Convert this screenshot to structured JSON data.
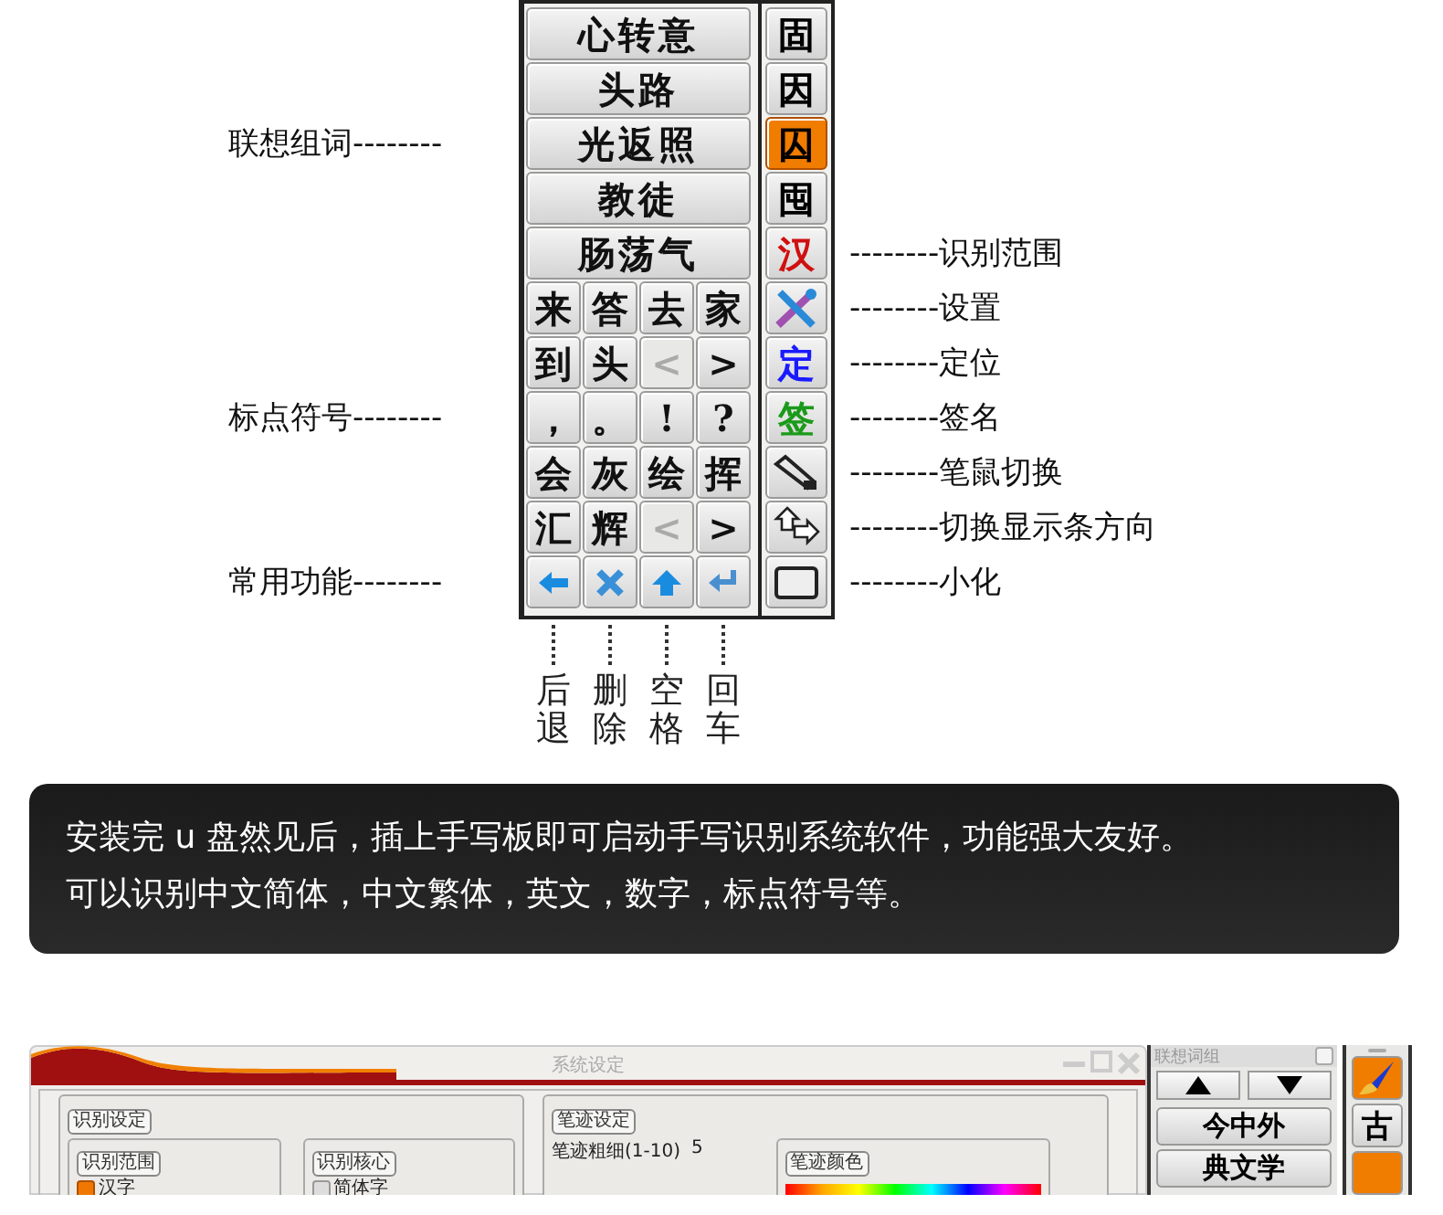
{
  "panel": {
    "word_group": {
      "callout": "联想组词--------",
      "words": [
        "心转意",
        "头路",
        "光返照",
        "教徒",
        "肠荡气"
      ]
    },
    "key_rows": [
      {
        "keys": [
          {
            "kind": "char",
            "label": "来",
            "disabled": false
          },
          {
            "kind": "char",
            "label": "答",
            "disabled": false
          },
          {
            "kind": "char",
            "label": "去",
            "disabled": false
          },
          {
            "kind": "char",
            "label": "家",
            "disabled": false
          }
        ]
      },
      {
        "keys": [
          {
            "kind": "char",
            "label": "到",
            "disabled": false
          },
          {
            "kind": "char",
            "label": "头",
            "disabled": false
          },
          {
            "kind": "char",
            "label": "<",
            "disabled": true
          },
          {
            "kind": "char",
            "label": ">",
            "disabled": false
          }
        ]
      },
      {
        "callout": "标点符号--------",
        "keys": [
          {
            "kind": "char",
            "label": "，",
            "disabled": false
          },
          {
            "kind": "char",
            "label": "。",
            "disabled": false
          },
          {
            "kind": "char",
            "label": "!",
            "disabled": false
          },
          {
            "kind": "char",
            "label": "?",
            "disabled": false
          }
        ]
      },
      {
        "keys": [
          {
            "kind": "char",
            "label": "会",
            "disabled": false
          },
          {
            "kind": "char",
            "label": "灰",
            "disabled": false
          },
          {
            "kind": "char",
            "label": "绘",
            "disabled": false
          },
          {
            "kind": "char",
            "label": "挥",
            "disabled": false
          }
        ]
      },
      {
        "keys": [
          {
            "kind": "char",
            "label": "汇",
            "disabled": false
          },
          {
            "kind": "char",
            "label": "辉",
            "disabled": false
          },
          {
            "kind": "char",
            "label": "<",
            "disabled": true
          },
          {
            "kind": "char",
            "label": ">",
            "disabled": false
          }
        ]
      },
      {
        "callout": "常用功能--------",
        "keys": [
          {
            "kind": "back",
            "disabled": false
          },
          {
            "kind": "delete",
            "disabled": false
          },
          {
            "kind": "space",
            "disabled": false
          },
          {
            "kind": "enter",
            "disabled": false
          }
        ]
      }
    ],
    "side_buttons": [
      {
        "kind": "char",
        "label": "固",
        "selected": false,
        "color": "#000000"
      },
      {
        "kind": "char",
        "label": "因",
        "selected": false,
        "color": "#000000"
      },
      {
        "kind": "char",
        "label": "囚",
        "selected": true,
        "color": "#000000"
      },
      {
        "kind": "char",
        "label": "囤",
        "selected": false,
        "color": "#000000"
      },
      {
        "kind": "char",
        "label": "汉",
        "selected": false,
        "color": "#d01010",
        "callout": "--------识别范围"
      },
      {
        "kind": "tools",
        "selected": false,
        "callout": "--------设置"
      },
      {
        "kind": "char",
        "label": "定",
        "selected": false,
        "color": "#1a1aff",
        "callout": "--------定位"
      },
      {
        "kind": "char",
        "label": "签",
        "selected": false,
        "color": "#1a9a1a",
        "callout": "--------签名"
      },
      {
        "kind": "pen",
        "selected": false,
        "callout": "--------笔鼠切换"
      },
      {
        "kind": "arrows",
        "selected": false,
        "callout": "--------切换显示条方向"
      },
      {
        "kind": "window",
        "selected": false,
        "callout": "--------小化"
      }
    ],
    "bottom_labels": [
      "后退",
      "删除",
      "空格",
      "回车"
    ]
  },
  "notice": {
    "lines": [
      "安装完 u 盘然见后，插上手写板即可启动手写识别系统软件，功能强大友好。",
      "可以识别中文简体，中文繁体，英文，数字，标点符号等。"
    ]
  },
  "settings_window": {
    "title": "系统设定",
    "recognition": {
      "title": "识别设定",
      "subgroups": [
        {
          "title": "识别范围",
          "options": [
            {
              "label": "汉字",
              "selected": true
            }
          ]
        },
        {
          "title": "识别核心",
          "options": [
            {
              "label": "简体字",
              "selected": false
            }
          ]
        }
      ]
    },
    "stroke": {
      "title": "笔迹设定",
      "width_label": "笔迹粗细(1-10)",
      "width_value": "5",
      "color_title": "笔迹颜色"
    }
  },
  "word_window": {
    "title": "联想词组",
    "words": [
      "今中外",
      "典文学"
    ]
  },
  "side_strip": [
    {
      "kind": "pen",
      "selected": true
    },
    {
      "kind": "char",
      "label": "古",
      "selected": false
    },
    {
      "kind": "blank",
      "selected": true
    }
  ]
}
